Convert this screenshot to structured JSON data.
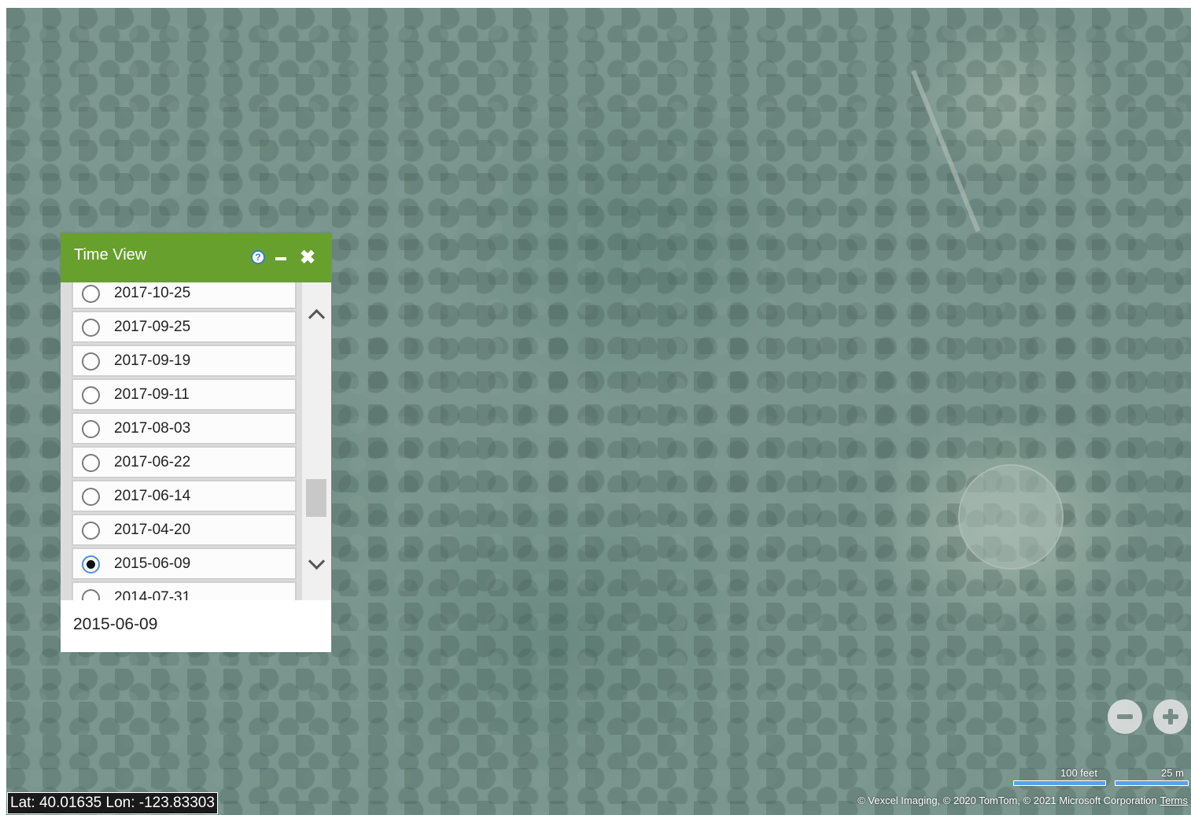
{
  "map": {
    "coordinates": "Lat: 40.01635 Lon: -123.83303",
    "zoom_out_label": "−",
    "zoom_in_label": "+",
    "scale_feet": "100 feet",
    "scale_meters": "25 m",
    "copyright": "© Vexcel Imaging, © 2020 TomTom, © 2021 Microsoft Corporation",
    "terms_link": "Terms"
  },
  "time_view": {
    "title": "Time View",
    "help_glyph": "?",
    "close_glyph": "✖",
    "dates": [
      "2017-10-25",
      "2017-09-25",
      "2017-09-19",
      "2017-09-11",
      "2017-08-03",
      "2017-06-22",
      "2017-06-14",
      "2017-04-20",
      "2015-06-09",
      "2014-07-31"
    ],
    "selected_date": "2015-06-09"
  }
}
